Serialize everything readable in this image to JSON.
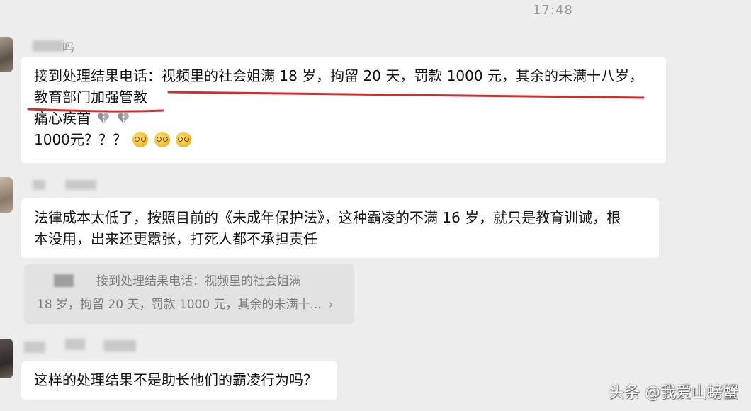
{
  "status": {
    "time": "17:48"
  },
  "messages": [
    {
      "sender_suffix": "吗",
      "lines": [
        "接到处理结果电话：视频里的社会姐满 18 岁，拘留 20 天，罚款 1000 元，其余的未满十八岁，",
        "教育部门加强管教",
        "痛心疾首",
        "1000元？？？"
      ],
      "emphasis_color": "#d42b2b",
      "icons": [
        "broken-heart-icon",
        "broken-heart-icon",
        "grimace-face-icon",
        "grimace-face-icon",
        "grimace-face-icon"
      ]
    },
    {
      "lines": [
        "法律成本太低了，按照目前的《未成年保护法》，这种霸凌的不满 16 岁，就只是教育训诫，根",
        "本没用，出来还更嚣张，打死人都不承担责任"
      ],
      "quote": {
        "line1": "接到处理结果电话：视频里的社会姐满",
        "line2": "18 岁，拘留 20 天，罚款 1000 元，其余的未满十...",
        "chevron": "›"
      }
    },
    {
      "lines": [
        "这样的处理结果不是助长他们的霸凌行为吗？"
      ]
    }
  ],
  "watermark": "头条 @我爱山螃蟹"
}
